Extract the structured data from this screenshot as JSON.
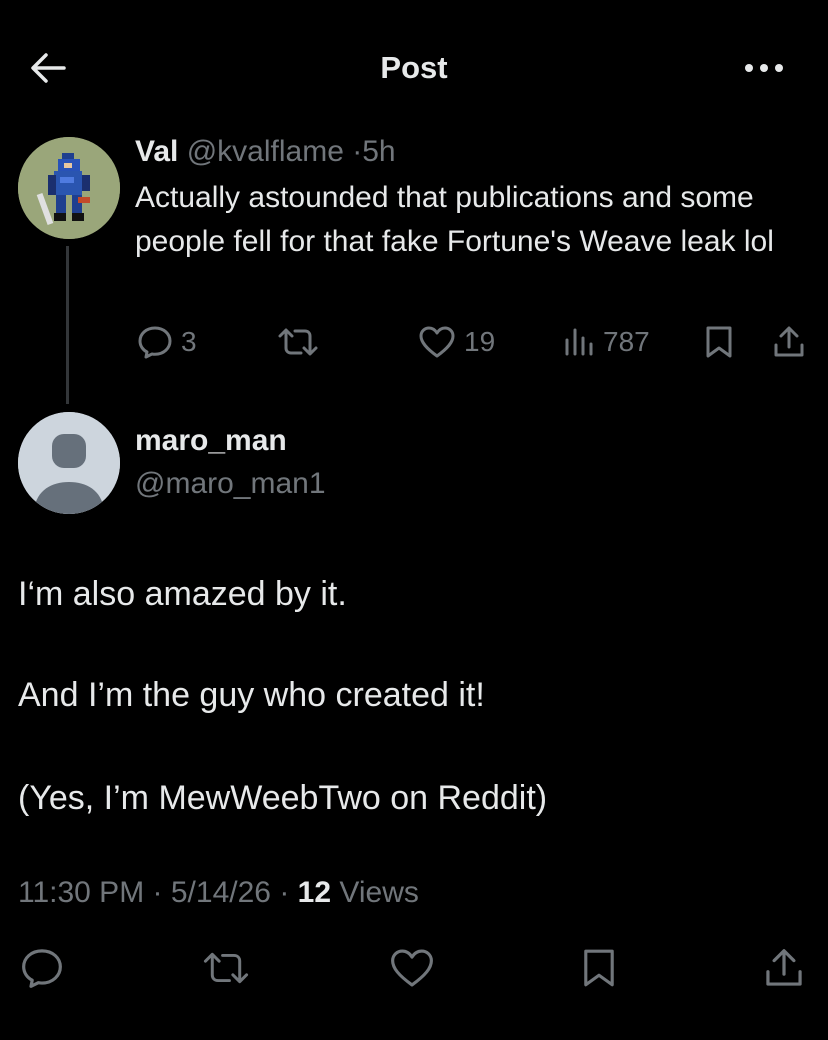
{
  "header": {
    "title": "Post",
    "back_icon": "arrow-left-icon",
    "more_icon": "more-dots-icon"
  },
  "parent_post": {
    "name": "Val",
    "handle": "@kvalflame",
    "separator": "·",
    "time": "5h",
    "text": "Actually astounded that publications and some people fell for that fake Fortune's Weave leak lol",
    "actions": {
      "replies": "3",
      "likes": "19",
      "views": "787"
    }
  },
  "reply_post": {
    "name": "maro_man",
    "handle": "@maro_man1",
    "paragraphs": [
      "I‘m also amazed by it.",
      "And I’m the guy who created it!",
      "(Yes, I’m MewWeebTwo on Reddit)"
    ],
    "time": "11:30 PM",
    "date": "5/14/26",
    "separator": "·",
    "views_count": "12",
    "views_label": "Views"
  },
  "colors": {
    "background": "#000000",
    "text_primary": "#e7e9ea",
    "text_secondary": "#71767b",
    "thread_line": "#333639"
  }
}
